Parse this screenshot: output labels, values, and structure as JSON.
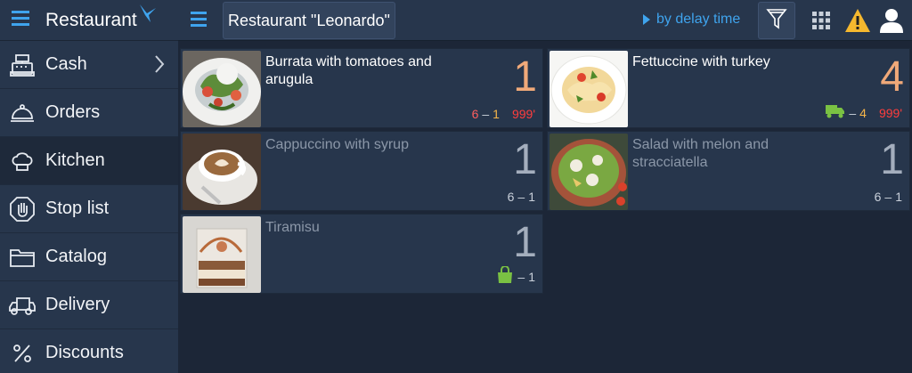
{
  "sidebar": {
    "title": "Restaurant",
    "items": [
      {
        "label": "Cash",
        "icon": "cash-register-icon",
        "has_submenu": true
      },
      {
        "label": "Orders",
        "icon": "cloche-icon"
      },
      {
        "label": "Kitchen",
        "icon": "chef-hat-icon",
        "active": true
      },
      {
        "label": "Stop list",
        "icon": "stop-hand-icon"
      },
      {
        "label": "Catalog",
        "icon": "folder-icon"
      },
      {
        "label": "Delivery",
        "icon": "delivery-truck-icon"
      },
      {
        "label": "Discounts",
        "icon": "percent-icon"
      }
    ]
  },
  "topbar": {
    "title": "Restaurant \"Leonardo\"",
    "sort_label": "by delay time"
  },
  "colors": {
    "accent": "#3fa4ee",
    "qty_orange": "#f0a979",
    "delay_red": "#ff3d3d",
    "warning": "#f5b82e",
    "green": "#7ac143"
  },
  "cards": [
    {
      "name": "Burrata with tomatoes and arugula",
      "qty": "1",
      "table": "6",
      "dash": "–",
      "count": "1",
      "delay": "999'"
    },
    {
      "name": "Fettuccine with turkey",
      "qty": "4",
      "dash": "–",
      "count": "4",
      "delay": "999'",
      "icon": "delivery-truck-icon"
    },
    {
      "name": "Cappuccino with syrup",
      "qty": "1",
      "table": "6",
      "dash": "–",
      "count": "1"
    },
    {
      "name": "Salad with melon and stracciatella",
      "qty": "1",
      "table": "6",
      "dash": "–",
      "count": "1"
    },
    {
      "name": "Tiramisu",
      "qty": "1",
      "dash": "–",
      "count": "1",
      "icon": "shopping-bag-icon"
    }
  ]
}
